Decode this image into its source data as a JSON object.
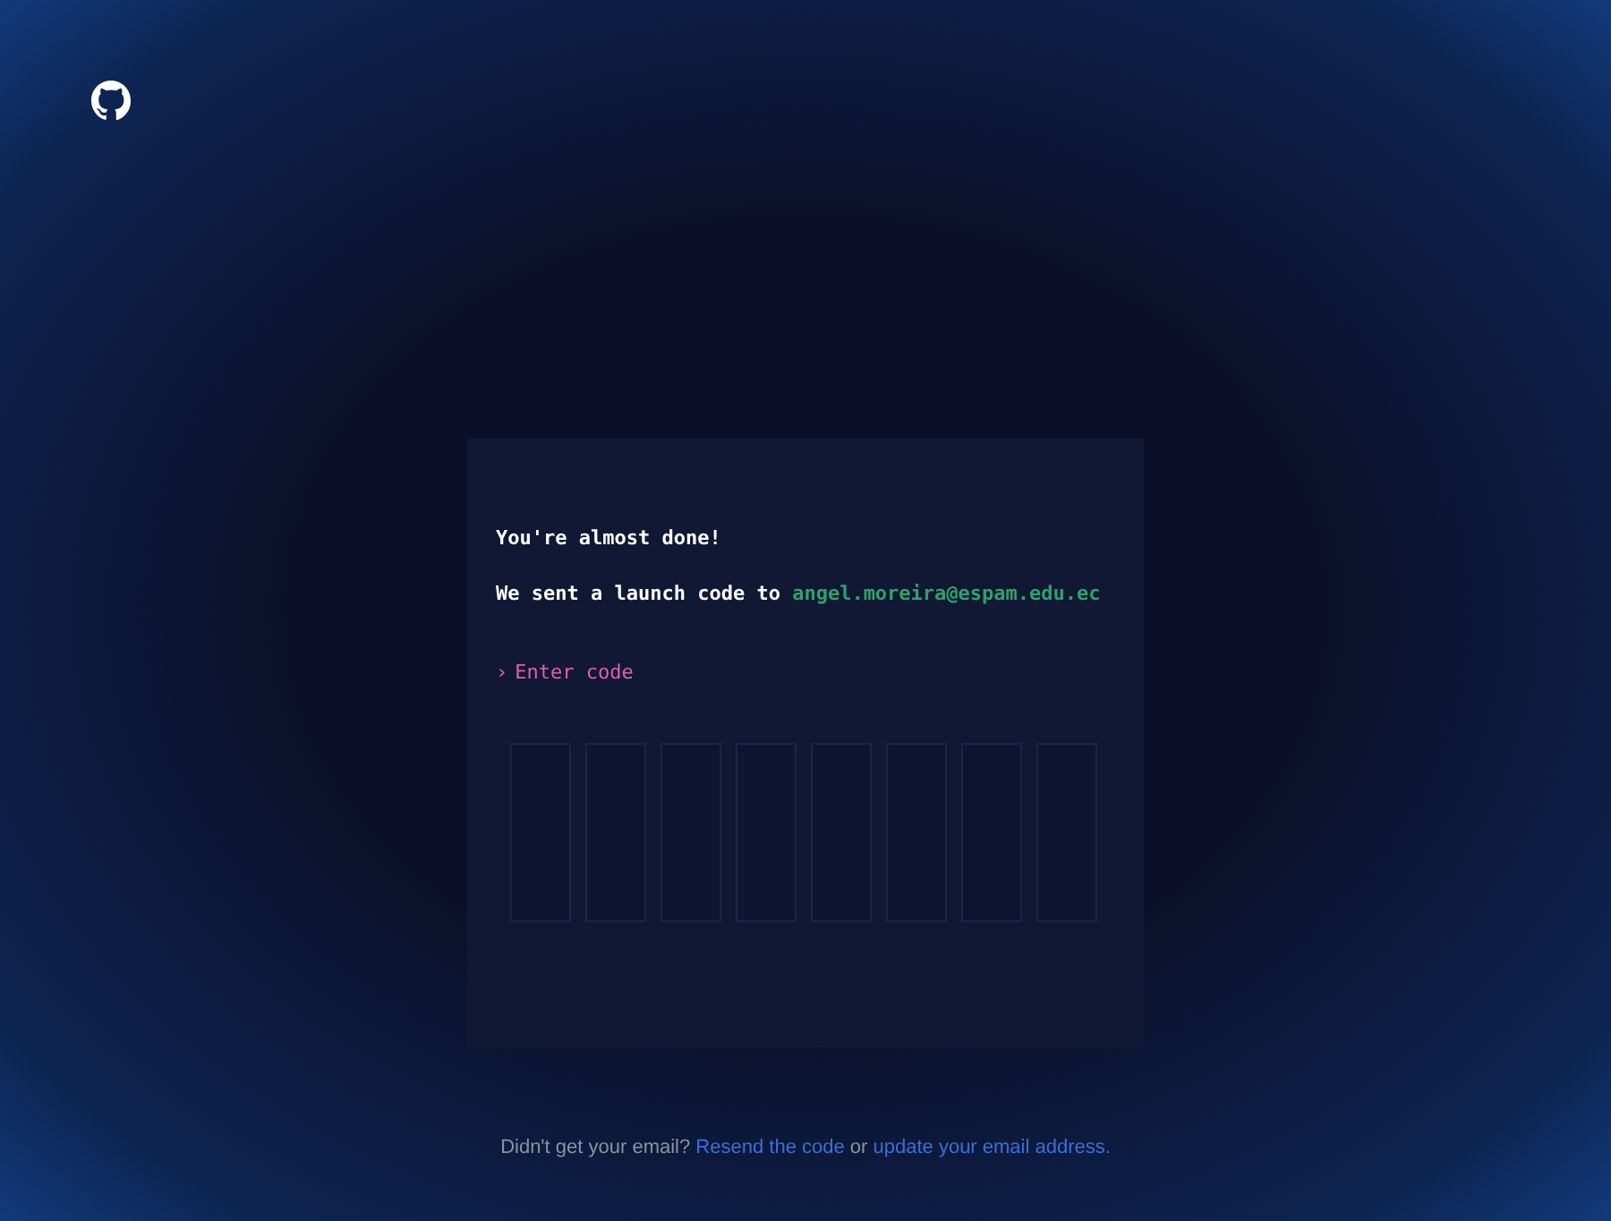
{
  "card": {
    "title": "You're almost done!",
    "message": "We sent a launch code to",
    "email": "angel.moreira@espam.edu.ec",
    "prompt_marker": "›",
    "prompt": "Enter code",
    "code_boxes": [
      {
        "filled": false
      },
      {
        "filled": false
      },
      {
        "filled": false
      },
      {
        "filled": false
      },
      {
        "filled": false
      },
      {
        "filled": false
      },
      {
        "filled": false
      },
      {
        "filled": false
      }
    ]
  },
  "footer": {
    "text": "Didn't get your email?",
    "resend_link": "Resend the code",
    "separator": "or",
    "update_link": "update your email address."
  }
}
